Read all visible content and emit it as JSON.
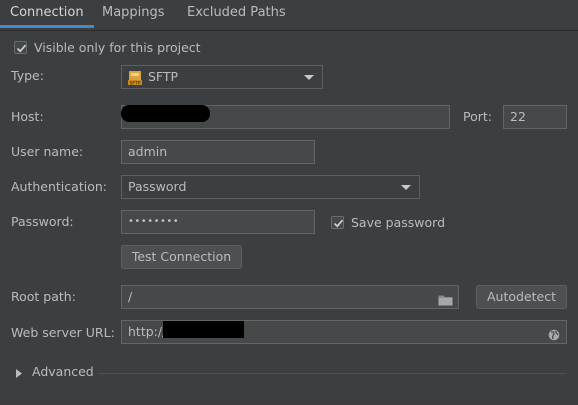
{
  "tabs": [
    {
      "label": "Connection"
    },
    {
      "label": "Mappings"
    },
    {
      "label": "Excluded Paths"
    }
  ],
  "visible_only": {
    "label": "Visible only for this project",
    "checked": true
  },
  "type": {
    "label": "Type:",
    "value": "SFTP",
    "icon": "sftp-icon"
  },
  "host": {
    "label": "Host:",
    "value": ""
  },
  "port": {
    "label": "Port:",
    "value": "22"
  },
  "username": {
    "label": "User name:",
    "value": "admin"
  },
  "authentication": {
    "label": "Authentication:",
    "value": "Password"
  },
  "password": {
    "label": "Password:",
    "value": "••••••••"
  },
  "save_password": {
    "label": "Save password",
    "checked": true
  },
  "test_connection": {
    "label": "Test Connection"
  },
  "root_path": {
    "label": "Root path:",
    "value": "/"
  },
  "autodetect": {
    "label": "Autodetect"
  },
  "web_server_url": {
    "label": "Web server URL:",
    "value": "http://"
  },
  "advanced": {
    "label": "Advanced"
  },
  "colors": {
    "accent": "#4a88c7",
    "background": "#3c3f41",
    "text": "#bbbbbb"
  }
}
